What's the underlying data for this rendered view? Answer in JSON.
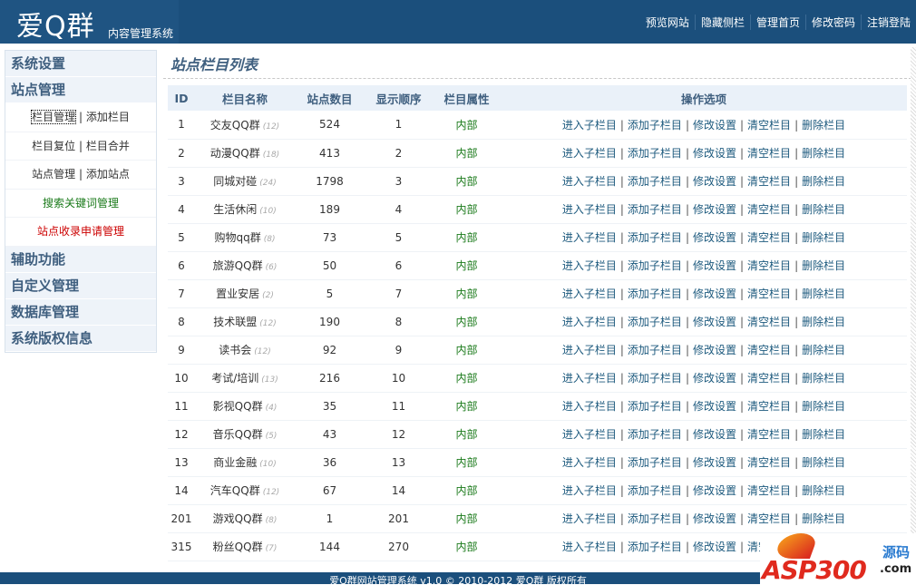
{
  "header": {
    "logo": "爱Q群",
    "subtitle": "内容管理系统",
    "nav": [
      "预览网站",
      "隐藏侧栏",
      "管理首页",
      "修改密码",
      "注销登陆"
    ],
    "bg_color": "#1b4f7c"
  },
  "sidebar": {
    "sections": [
      "系统设置",
      "站点管理"
    ],
    "items": [
      {
        "a": "栏目管理",
        "b": "添加栏目"
      },
      {
        "a": "栏目复位",
        "b": "栏目合并"
      },
      {
        "a": "站点管理",
        "b": "添加站点"
      }
    ],
    "keyword_link": "搜索关键词管理",
    "keyword_color": "#1a7a1a",
    "apply_link": "站点收录申请管理",
    "apply_color": "#cc0000",
    "sections_after": [
      "辅助功能",
      "自定义管理",
      "数据库管理",
      "系统版权信息"
    ]
  },
  "main": {
    "title": "站点栏目列表",
    "columns": [
      "ID",
      "栏目名称",
      "站点数目",
      "显示顺序",
      "栏目属性",
      "操作选项"
    ],
    "ops": [
      "进入子栏目",
      "添加子栏目",
      "修改设置",
      "清空栏目",
      "删除栏目"
    ],
    "rows": [
      {
        "id": "1",
        "name": "交友QQ群",
        "sub": "(12)",
        "count": "524",
        "order": "1",
        "attr": "内部"
      },
      {
        "id": "2",
        "name": "动漫QQ群",
        "sub": "(18)",
        "count": "413",
        "order": "2",
        "attr": "内部"
      },
      {
        "id": "3",
        "name": "同城对碰",
        "sub": "(24)",
        "count": "1798",
        "order": "3",
        "attr": "内部"
      },
      {
        "id": "4",
        "name": "生活休闲",
        "sub": "(10)",
        "count": "189",
        "order": "4",
        "attr": "内部"
      },
      {
        "id": "5",
        "name": "购物qq群",
        "sub": "(8)",
        "count": "73",
        "order": "5",
        "attr": "内部"
      },
      {
        "id": "6",
        "name": "旅游QQ群",
        "sub": "(6)",
        "count": "50",
        "order": "6",
        "attr": "内部"
      },
      {
        "id": "7",
        "name": "置业安居",
        "sub": "(2)",
        "count": "5",
        "order": "7",
        "attr": "内部"
      },
      {
        "id": "8",
        "name": "技术联盟",
        "sub": "(12)",
        "count": "190",
        "order": "8",
        "attr": "内部"
      },
      {
        "id": "9",
        "name": "读书会",
        "sub": "(12)",
        "count": "92",
        "order": "9",
        "attr": "内部"
      },
      {
        "id": "10",
        "name": "考试/培训",
        "sub": "(13)",
        "count": "216",
        "order": "10",
        "attr": "内部"
      },
      {
        "id": "11",
        "name": "影视QQ群",
        "sub": "(4)",
        "count": "35",
        "order": "11",
        "attr": "内部"
      },
      {
        "id": "12",
        "name": "音乐QQ群",
        "sub": "(5)",
        "count": "43",
        "order": "12",
        "attr": "内部"
      },
      {
        "id": "13",
        "name": "商业金融",
        "sub": "(10)",
        "count": "36",
        "order": "13",
        "attr": "内部"
      },
      {
        "id": "14",
        "name": "汽车QQ群",
        "sub": "(12)",
        "count": "67",
        "order": "14",
        "attr": "内部"
      },
      {
        "id": "201",
        "name": "游戏QQ群",
        "sub": "(8)",
        "count": "1",
        "order": "201",
        "attr": "内部"
      },
      {
        "id": "315",
        "name": "粉丝QQ群",
        "sub": "(7)",
        "count": "144",
        "order": "270",
        "attr": "内部"
      }
    ]
  },
  "footer": {
    "text": "爱Q群网站管理系统 v1.0 © 2010-2012 爱Q群 版权所有"
  },
  "watermark": {
    "logo": "ASP300",
    "cn": "源码",
    "com": ".com"
  }
}
